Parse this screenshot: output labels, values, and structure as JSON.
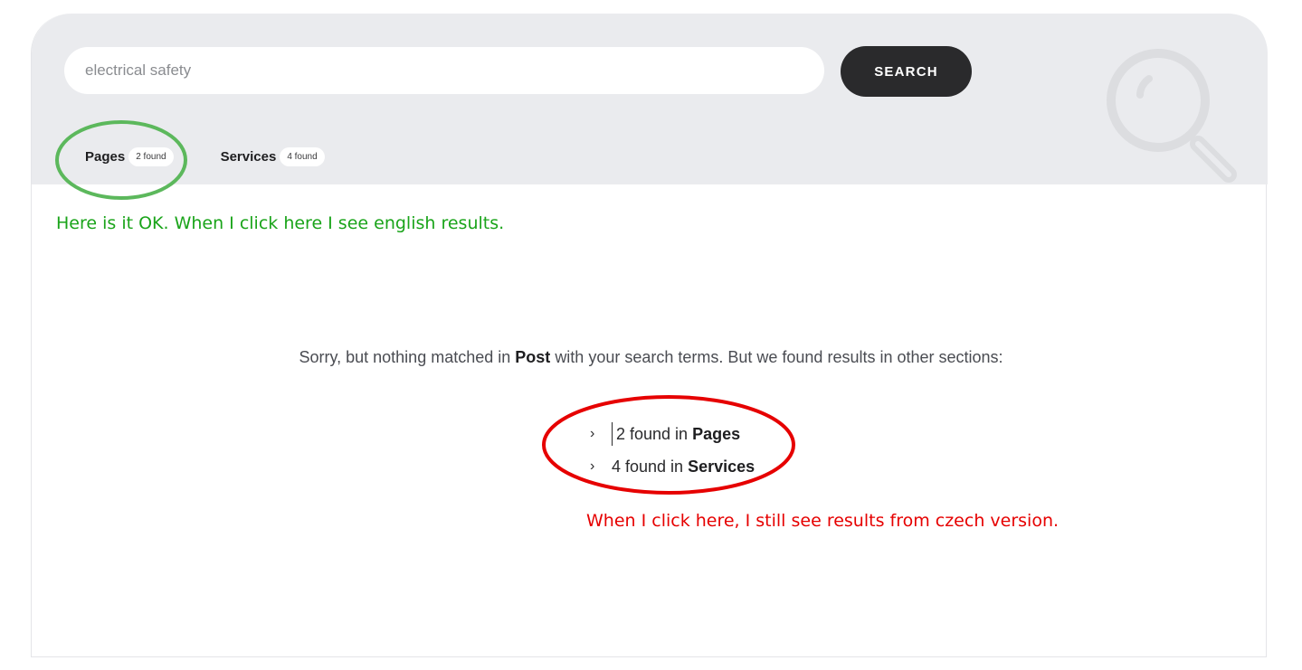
{
  "search": {
    "value": "electrical safety",
    "button_label": "SEARCH"
  },
  "tabs": [
    {
      "label": "Pages",
      "count": "2 found"
    },
    {
      "label": "Services",
      "count": "4 found"
    }
  ],
  "annotations": {
    "green_note": "Here is it OK. When I click here I see english results.",
    "red_note": "When I click here, I still see results from czech version.",
    "green_color": "#5cb85c",
    "red_color": "#e60000"
  },
  "message": {
    "prefix": "Sorry, but nothing matched in",
    "section": "Post",
    "suffix": "with your search terms. But we found results in other sections:"
  },
  "results": [
    {
      "count_text": "2 found in",
      "section": "Pages"
    },
    {
      "count_text": "4 found in",
      "section": "Services"
    }
  ],
  "icons": {
    "background": "magnifier-icon",
    "list_marker": "chevron-right-icon"
  }
}
